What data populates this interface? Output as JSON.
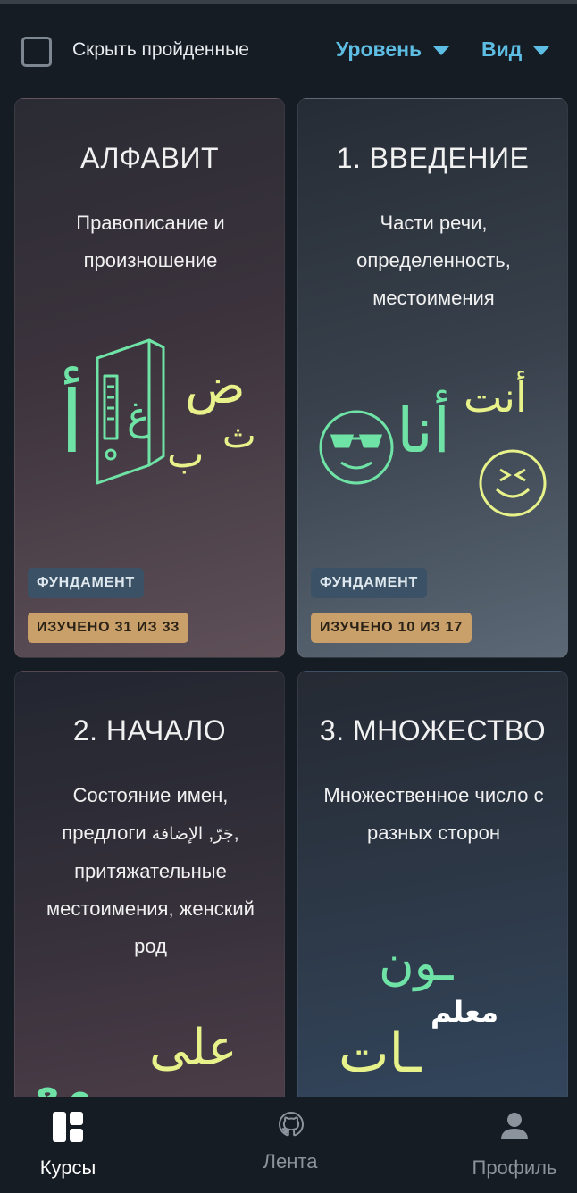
{
  "filters": {
    "hide_completed_label": "Скрыть пройденные",
    "hide_completed_checked": false,
    "level_label": "Уровень",
    "view_label": "Вид"
  },
  "courses": [
    {
      "title": "АЛФАВИТ",
      "subtitle": "Правописание и произношение",
      "art_letters": [
        "أ",
        "غ",
        "ض",
        "ث",
        "ب"
      ],
      "level": "ФУНДАМЕНТ",
      "progress": "ИЗУЧЕНО 31 ИЗ 33"
    },
    {
      "title": "1. ВВЕДЕНИЕ",
      "subtitle": "Части речи, определенность, местоимения",
      "art_words": [
        "أنا",
        "أنت"
      ],
      "level": "ФУНДАМЕНТ",
      "progress": "ИЗУЧЕНО 10 ИЗ 17"
    },
    {
      "title": "2. НАЧАЛО",
      "subtitle_part1": "Состояние имен, предлоги",
      "subtitle_ar1": "جَرّ",
      "subtitle_ar2": "الإضافة",
      "subtitle_part2": "притяжательные местоимения, женский род",
      "art_words": [
        "على",
        "مع"
      ]
    },
    {
      "title": "3. МНОЖЕСТВО",
      "subtitle": "Множественное число с разных сторон",
      "art_words": [
        "ـون",
        "معلم",
        "ـات"
      ]
    }
  ],
  "nav": {
    "courses": "Курсы",
    "feed": "Лента",
    "profile": "Профиль"
  },
  "colors": {
    "accent": "#5dbde3",
    "art_green": "#6fe3a6",
    "art_yellow": "#e8f28a",
    "progress_badge": "#c9a06a",
    "level_badge": "#3b5266"
  }
}
